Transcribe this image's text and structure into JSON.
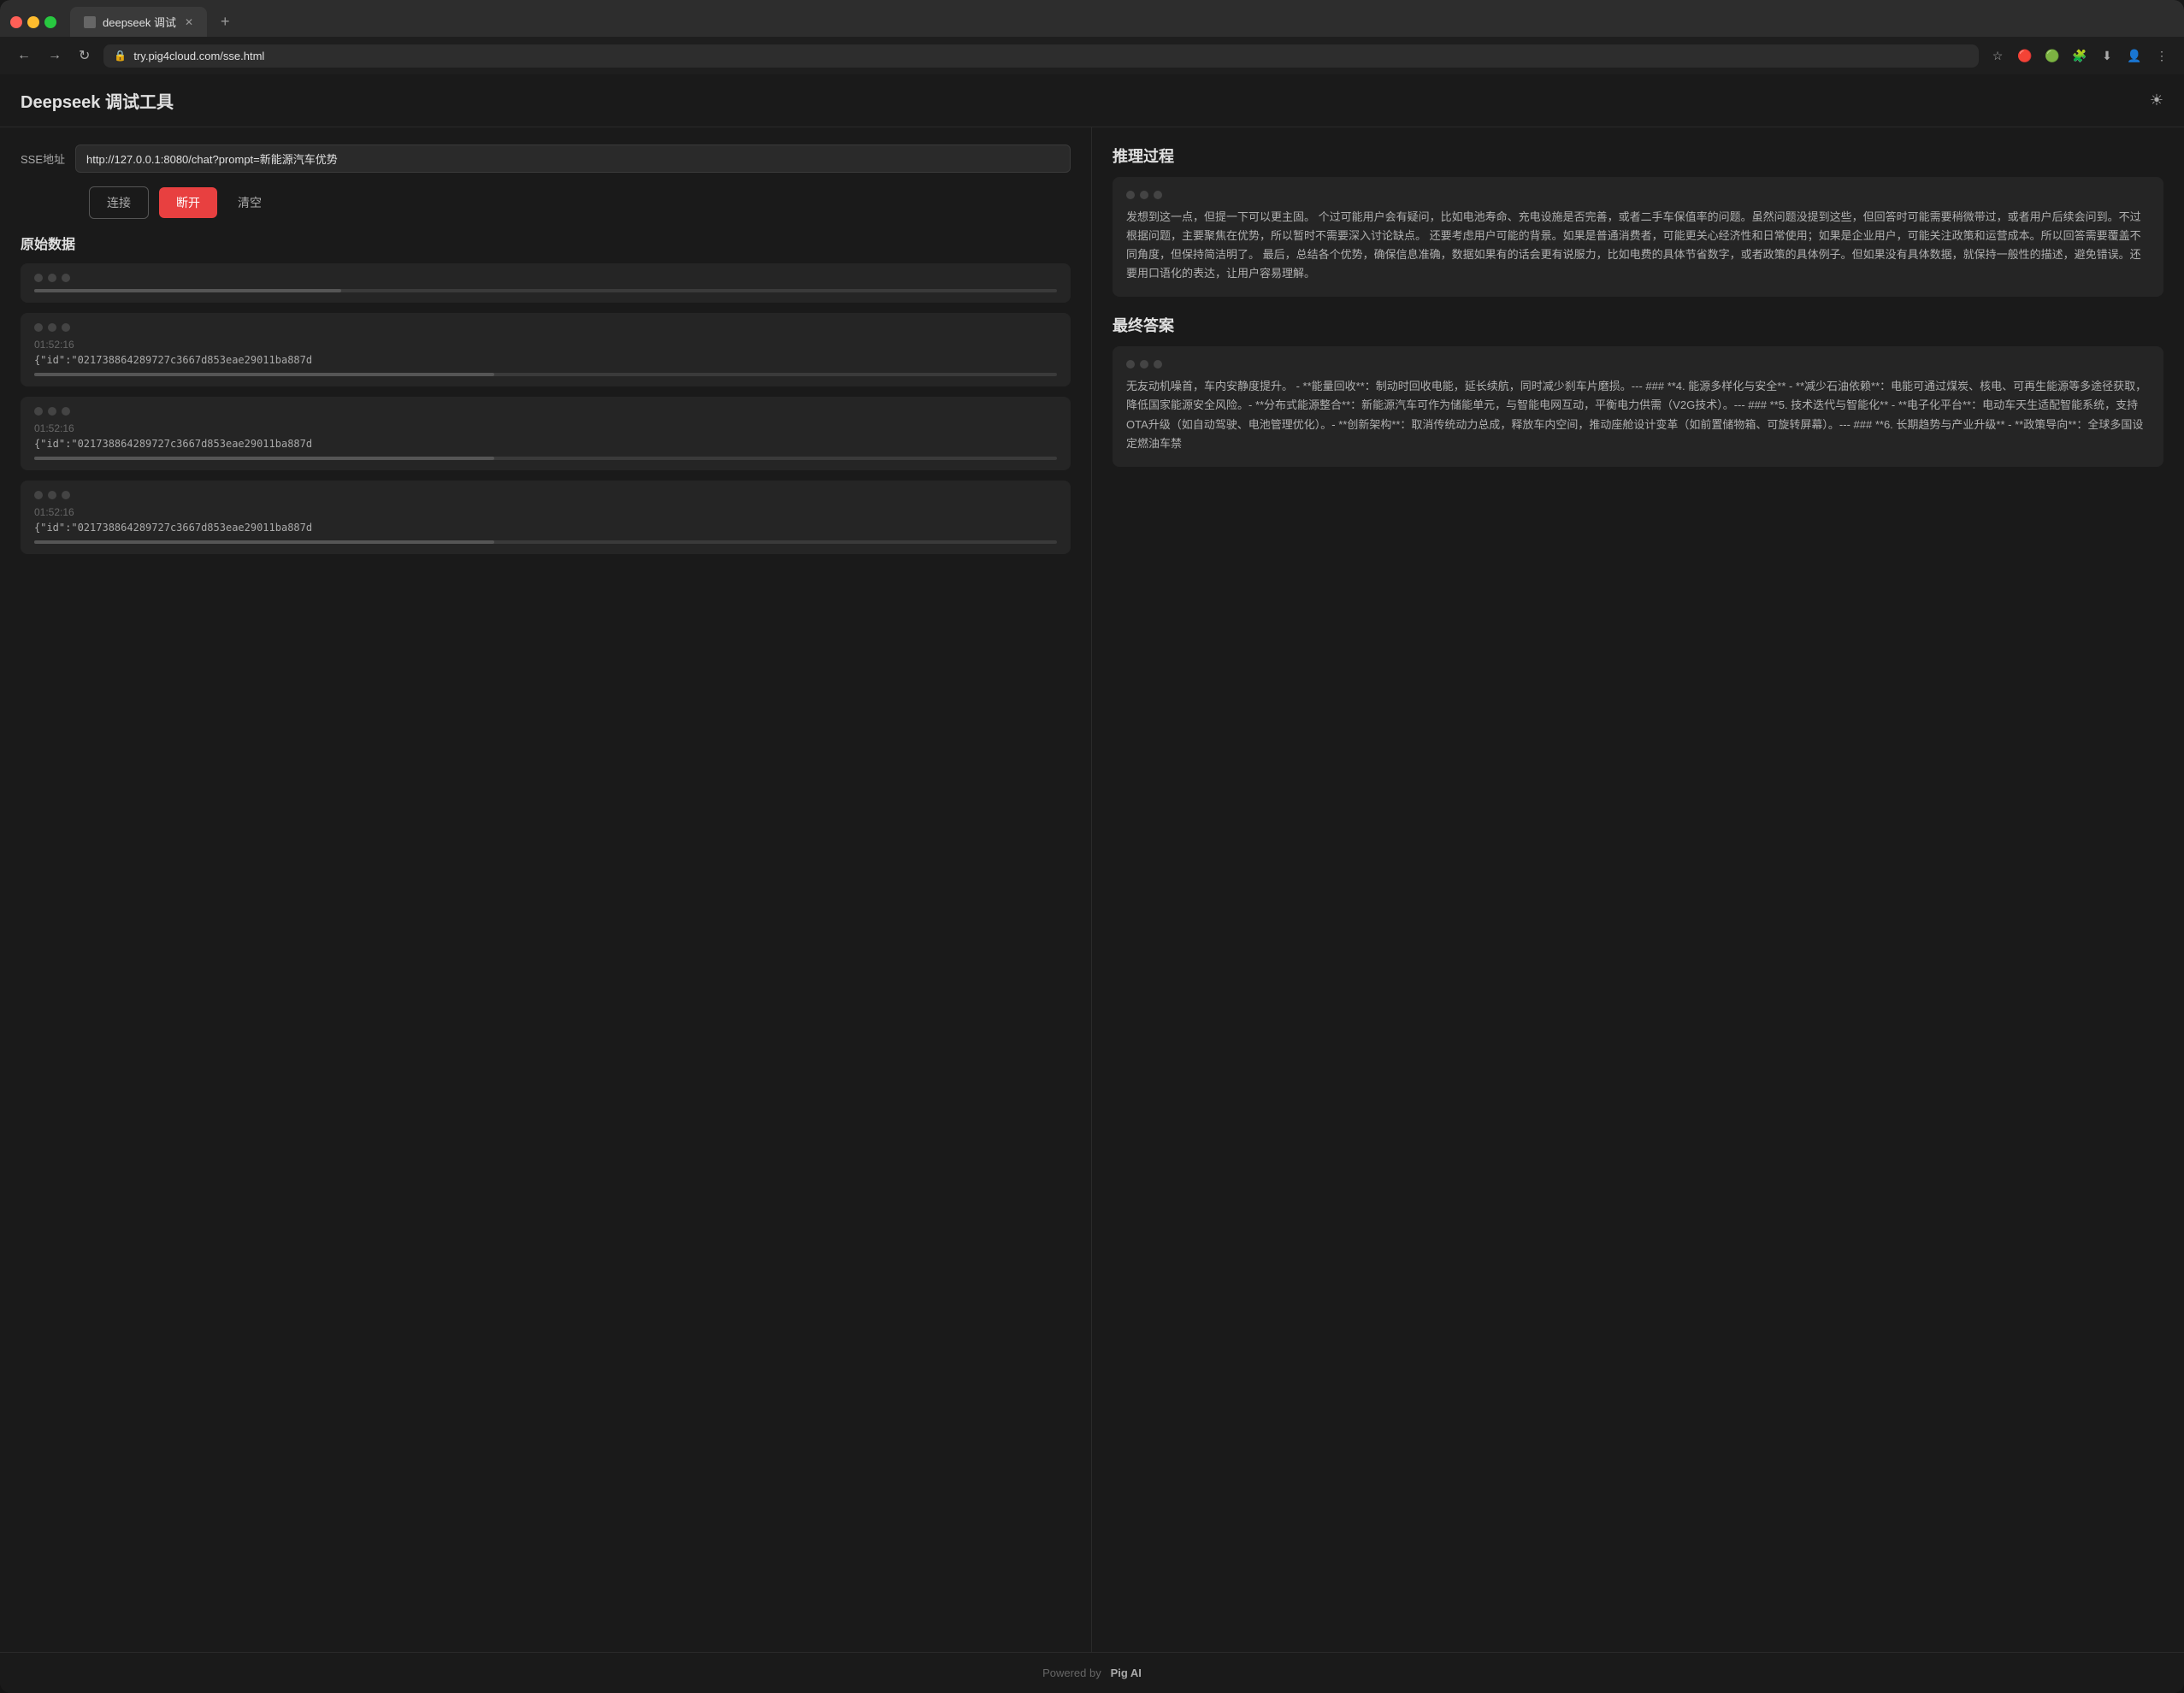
{
  "browser": {
    "tab_title": "deepseek 调试",
    "url": "try.pig4cloud.com/sse.html",
    "new_tab_icon": "+",
    "back_icon": "←",
    "forward_icon": "→",
    "reload_icon": "↻"
  },
  "app": {
    "title": "Deepseek 调试工具",
    "theme_icon": "☀"
  },
  "left": {
    "sse_label": "SSE地址",
    "sse_value": "http://127.0.0.1:8080/chat?prompt=新能源汽车优势",
    "btn_connect": "连接",
    "btn_disconnect": "断开",
    "btn_clear": "清空",
    "raw_data_title": "原始数据",
    "cards": [
      {
        "timestamp": "",
        "content": "",
        "progress_width": "30%"
      },
      {
        "timestamp": "01:52:16",
        "content": "{\"id\":\"021738864289727c3667d853eae29011ba887d",
        "progress_width": "45%"
      },
      {
        "timestamp": "01:52:16",
        "content": "{\"id\":\"021738864289727c3667d853eae29011ba887d",
        "progress_width": "45%"
      },
      {
        "timestamp": "01:52:16",
        "content": "{\"id\":\"021738864289727c3667d853eae29011ba887d",
        "progress_width": "45%"
      }
    ]
  },
  "right": {
    "reasoning_title": "推理过程",
    "reasoning_text": "发想到这一点，但提一下可以更主固。 个过可能用户会有疑问，比如电池寿命、充电设施是否完善，或者二手车保值率的问题。虽然问题没提到这些，但回答时可能需要稍微带过，或者用户后续会问到。不过根据问题，主要聚焦在优势，所以暂时不需要深入讨论缺点。 还要考虑用户可能的背景。如果是普通消费者，可能更关心经济性和日常使用；如果是企业用户，可能关注政策和运营成本。所以回答需要覆盖不同角度，但保持简洁明了。 最后，总结各个优势，确保信息准确，数据如果有的话会更有说服力，比如电费的具体节省数字，或者政策的具体例子。但如果没有具体数据，就保持一般性的描述，避免错误。还要用口语化的表达，让用户容易理解。",
    "answer_title": "最终答案",
    "answer_text": "无友动机噪首，车内安静度提升。 - **能量回收**：制动时回收电能，延长续航，同时减少刹车片磨损。--- ### **4. 能源多样化与安全** - **减少石油依赖**：电能可通过煤炭、核电、可再生能源等多途径获取，降低国家能源安全风险。- **分布式能源整合**：新能源汽车可作为储能单元，与智能电网互动，平衡电力供需（V2G技术）。--- ### **5. 技术迭代与智能化** - **电子化平台**：电动车天生适配智能系统，支持OTA升级（如自动驾驶、电池管理优化）。- **创新架构**：取消传统动力总成，释放车内空间，推动座舱设计变革（如前置储物箱、可旋转屏幕）。--- ### **6. 长期趋势与产业升级** - **政策导向**：全球多国设定燃油车禁",
    "footer_powered": "Powered by",
    "footer_brand": "Pig AI"
  }
}
